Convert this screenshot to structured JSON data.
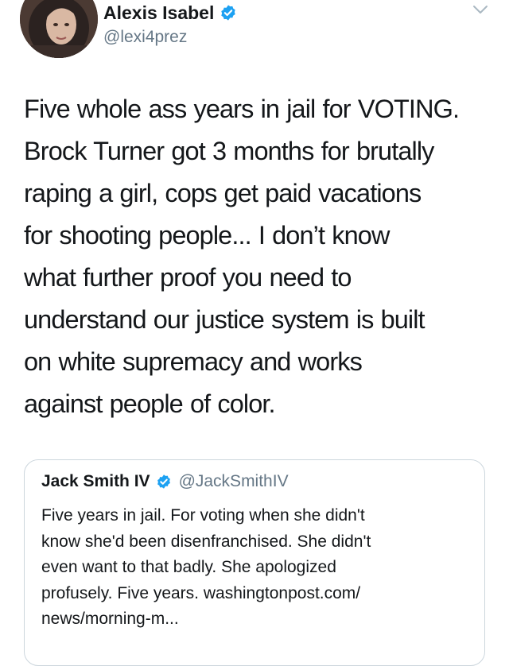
{
  "tweet": {
    "display_name": "Alexis Isabel",
    "handle": "@lexi4prez",
    "text_lines": [
      "Five whole ass years in jail for VOTING.",
      "Brock Turner got 3 months for brutally",
      "raping a girl, cops get paid vacations",
      "for shooting people... I don’t know",
      "what further proof you need to",
      "understand our justice system is built",
      "on white supremacy and works",
      "against people of color."
    ],
    "verified_icon": "verified-badge-icon",
    "menu_icon": "chevron-down-icon"
  },
  "quoted_tweet": {
    "display_name": "Jack Smith IV",
    "handle": "@JackSmithIV",
    "text_lines": [
      "Five years in jail. For voting when she didn't",
      "know she'd been disenfranchised. She didn't",
      "even want to that badly. She apologized",
      "profusely. Five years. washingtonpost.com/",
      "news/morning-m..."
    ]
  },
  "colors": {
    "text": "#14171a",
    "secondary": "#657786",
    "verified": "#1da1f2",
    "border": "#ccd6dd"
  }
}
